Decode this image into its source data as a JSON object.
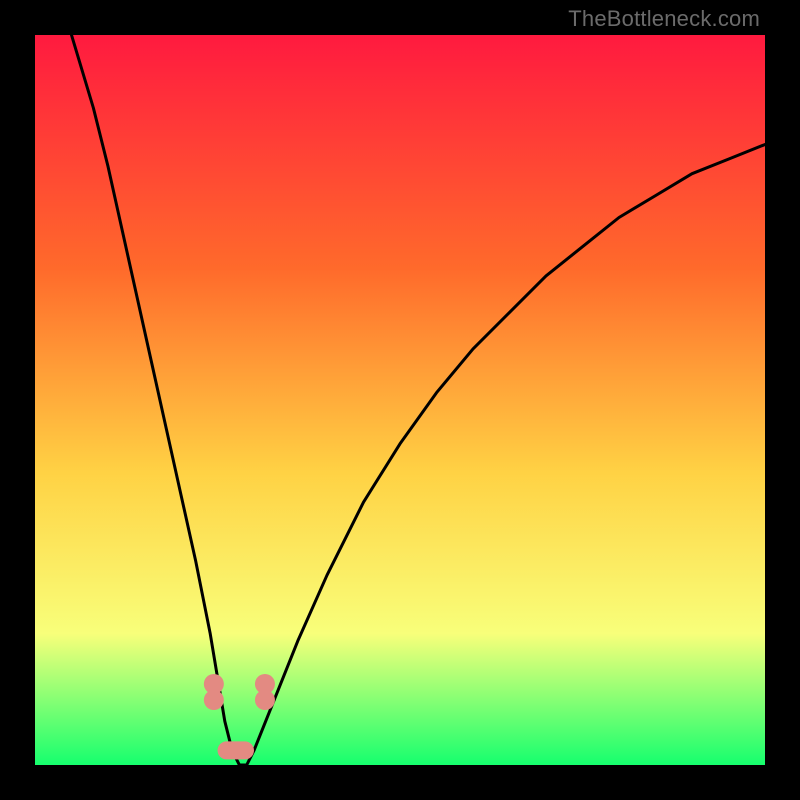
{
  "watermark": "TheBottleneck.com",
  "chart_data": {
    "type": "line",
    "title": "",
    "xlabel": "",
    "ylabel": "",
    "xlim": [
      0,
      100
    ],
    "ylim": [
      0,
      100
    ],
    "grid": false,
    "legend": false,
    "background_gradient": {
      "top_color": "#ff1a3f",
      "mid_color_1": "#ff6a2b",
      "mid_color_2": "#ffd244",
      "mid_color_3": "#f8ff7a",
      "bottom_color": "#16ff6e"
    },
    "series": [
      {
        "name": "bottleneck-curve",
        "x": [
          5,
          8,
          10,
          12,
          14,
          16,
          18,
          20,
          22,
          24,
          25,
          26,
          27,
          28,
          29,
          30,
          32,
          36,
          40,
          45,
          50,
          55,
          60,
          65,
          70,
          75,
          80,
          85,
          90,
          95,
          100
        ],
        "values": [
          100,
          90,
          82,
          73,
          64,
          55,
          46,
          37,
          28,
          18,
          12,
          6,
          2,
          0,
          0,
          2,
          7,
          17,
          26,
          36,
          44,
          51,
          57,
          62,
          67,
          71,
          75,
          78,
          81,
          83,
          85
        ]
      }
    ],
    "markers": [
      {
        "name": "marker-left",
        "cx": 24.5,
        "cy": 10,
        "color": "#e38a82"
      },
      {
        "name": "marker-right",
        "cx": 31.5,
        "cy": 10,
        "color": "#e38a82"
      },
      {
        "name": "bottom-bar",
        "x1": 25,
        "x2": 30,
        "y": 2,
        "color": "#e38a82"
      }
    ]
  }
}
